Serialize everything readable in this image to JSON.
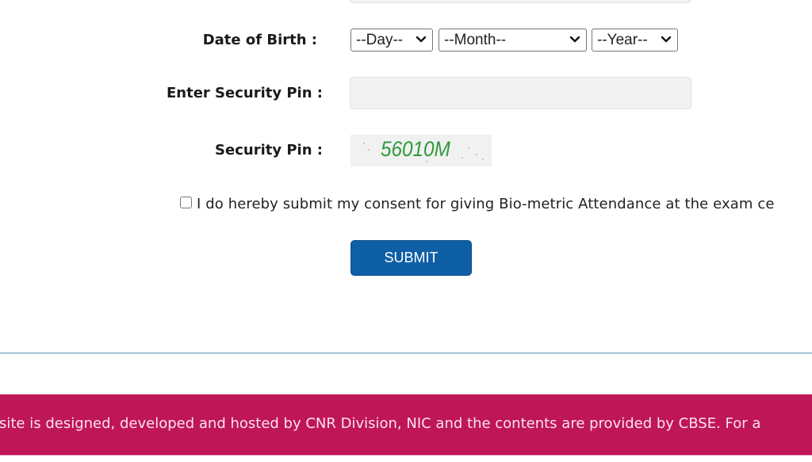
{
  "form": {
    "dob_label": "Date of Birth :",
    "day_select": {
      "selected": "--Day--"
    },
    "month_select": {
      "selected": "--Month--"
    },
    "year_select": {
      "selected": "--Year--"
    },
    "enter_pin_label": "Enter Security Pin :",
    "enter_pin_input": {
      "value": "",
      "placeholder": ""
    },
    "security_pin_label": "Security Pin :",
    "captcha_text": "56010M",
    "consent_text": "I do hereby submit my consent for giving Bio-metric Attendance at the exam ce",
    "consent_checked": false,
    "submit_label": "SUBMIT"
  },
  "footer": {
    "text": "site is designed, developed and hosted by CNR Division, NIC and the contents are provided by CBSE. For a"
  },
  "colors": {
    "submit_bg": "#0f5fa6",
    "footer_bg": "#bf1657",
    "captcha_text": "#2e9a3a",
    "divider": "#5b8fb5",
    "input_bg": "#f2f2f2"
  },
  "icons": {
    "select_arrow": "chevron-down-icon"
  }
}
